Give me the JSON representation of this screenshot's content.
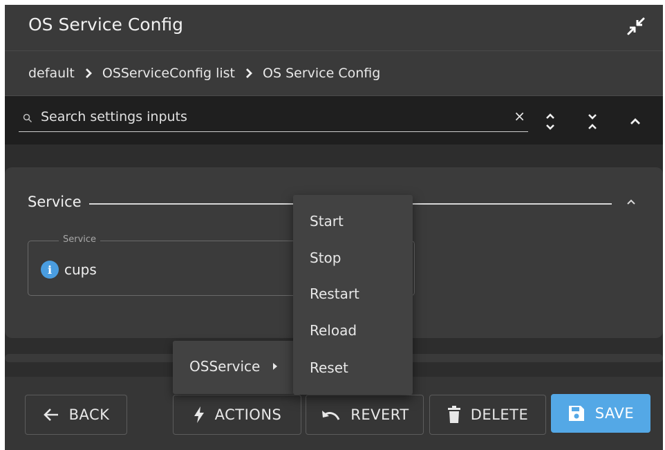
{
  "dialog": {
    "title": "OS Service Config",
    "collapse_icon": "collapse-arrows-icon"
  },
  "breadcrumb": {
    "items": [
      "default",
      "OSServiceConfig list",
      "OS Service Config"
    ]
  },
  "search": {
    "placeholder": "Search settings inputs",
    "value": "",
    "clear_label": "×"
  },
  "section": {
    "title": "Service",
    "field": {
      "legend": "Service",
      "value": "cups"
    }
  },
  "footer": {
    "back_label": "BACK",
    "actions_label": "ACTIONS",
    "revert_label": "REVERT",
    "delete_label": "DELETE",
    "save_label": "SAVE"
  },
  "actions_menu": {
    "items": [
      "OSService"
    ]
  },
  "submenu": {
    "items": [
      "Start",
      "Stop",
      "Restart",
      "Reload",
      "Reset"
    ]
  },
  "colors": {
    "accent": "#54a8e6",
    "info": "#4a9de0",
    "background": "#363636",
    "search_bar": "#1f1f1f"
  }
}
